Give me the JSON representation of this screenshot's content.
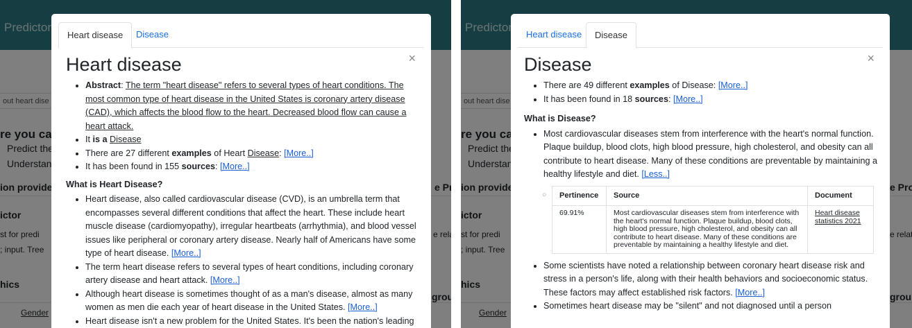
{
  "background": {
    "brand": "Predictor",
    "search_placeholder": "out heart dise",
    "heading": "re you car",
    "item1": "Predict the",
    "item2": "Understan",
    "section1": "ion provide",
    "section1_right": "e Prof",
    "section2": "ictor",
    "line1": "st for predi",
    "line1_right": "e relat",
    "line2": "; input. Tree",
    "section3": "hics",
    "group_label": "grou",
    "gender": "Gender"
  },
  "left_modal": {
    "tabs": [
      "Heart disease",
      "Disease"
    ],
    "active_tab": 0,
    "title": "Heart disease",
    "close": "×",
    "abstract_label": "Abstract",
    "abstract_text": "The term \"heart disease\" refers to several types of heart conditions. The most common type of heart disease in the United States is coronary artery disease (CAD), which affects the blood flow to the heart. Decreased blood flow can cause a heart attack.",
    "is_a_prefix": "It ",
    "is_a_bold": "is a",
    "is_a_value": "Disease",
    "examples_prefix": "There are 27 different ",
    "examples_bold": "examples",
    "examples_suffix": " of Heart ",
    "examples_link": "Disease",
    "sources_prefix": "It has been found in 155 ",
    "sources_bold": "sources",
    "more": "[More..]",
    "what_is": "What is Heart Disease?",
    "p1": "Heart disease, also called cardiovascular disease (CVD), is an umbrella term that encompasses several different conditions that affect the heart. These include heart muscle disease (cardiomyopathy), irregular heartbeats (arrhythmia), and blood vessel issues like peripheral or coronary artery disease. Nearly half of Americans have some type of heart disease.",
    "p2": "The term heart disease refers to several types of heart conditions, including coronary artery disease and heart attack.",
    "p3": "Although heart disease is sometimes thought of as a man's disease, almost as many women as men die each year of heart disease in the United States.",
    "p4": "Heart disease isn't a new problem for the United States. It's been the nation's leading"
  },
  "right_modal": {
    "tabs": [
      "Heart disease",
      "Disease"
    ],
    "active_tab": 1,
    "title": "Disease",
    "close": "×",
    "examples_prefix": "There are 49 different ",
    "examples_bold": "examples",
    "examples_suffix": " of Disease: ",
    "sources_prefix": "It has been found in 18 ",
    "sources_bold": "sources",
    "more": "[More..]",
    "less": "[Less..]",
    "what_is": "What is Disease?",
    "p1": "Most cardiovascular diseases stem from interference with the heart's normal function. Plaque buildup, blood clots, high blood pressure, high cholesterol, and obesity can all contribute to heart disease. Many of these conditions are preventable by maintaining a healthy lifestyle and diet.",
    "table_headers": [
      "Pertinence",
      "Source",
      "Document"
    ],
    "table_row": {
      "pertinence": "69.91%",
      "source": "Most cardiovascular diseases stem from interference with the heart's normal function. Plaque buildup, blood clots, high blood pressure, high cholesterol, and obesity can all contribute to heart disease. Many of these conditions are preventable by maintaining a healthy lifestyle and diet.",
      "document": "Heart disease statistics 2021"
    },
    "p2": "Some scientists have noted a relationship between coronary heart disease risk and stress in a person's life, along with their health behaviors and socioeconomic status. These factors may affect established risk factors.",
    "p3": "Sometimes heart disease may be \"silent\" and not diagnosed until a person"
  }
}
